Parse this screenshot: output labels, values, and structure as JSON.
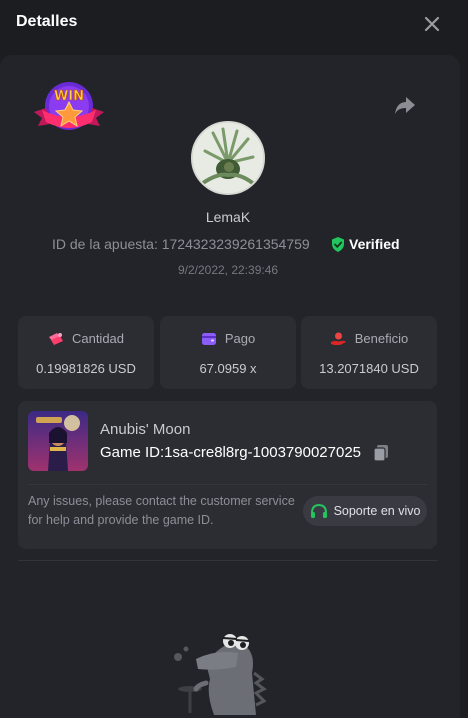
{
  "header": {
    "title": "Detalles"
  },
  "badge": {
    "text": "WIN"
  },
  "player": {
    "username": "LemaK",
    "bet_id_text": "ID de la apuesta: 1724323239261354759",
    "verified_label": "Verified",
    "timestamp": "9/2/2022, 22:39:46"
  },
  "stats": {
    "amount": {
      "label": "Cantidad",
      "value": "0.19981826 USD",
      "icon": "coins-icon",
      "color": "#ff4d6d"
    },
    "payout": {
      "label": "Pago",
      "value": "67.0959 x",
      "icon": "wallet-icon",
      "color": "#8b5cf6"
    },
    "profit": {
      "label": "Beneficio",
      "value": "13.2071840 USD",
      "icon": "hand-coin-icon",
      "color": "#e53935"
    }
  },
  "game": {
    "name": "Anubis' Moon",
    "game_id_text": "Game ID:1sa-cre8l8rg-1003790027025",
    "help_text": "Any issues, please contact the customer service for help and provide the game ID.",
    "support_label": "Soporte en vivo"
  },
  "colors": {
    "verified_green": "#22c55e",
    "panel": "#232429",
    "card": "#2c2d33"
  }
}
